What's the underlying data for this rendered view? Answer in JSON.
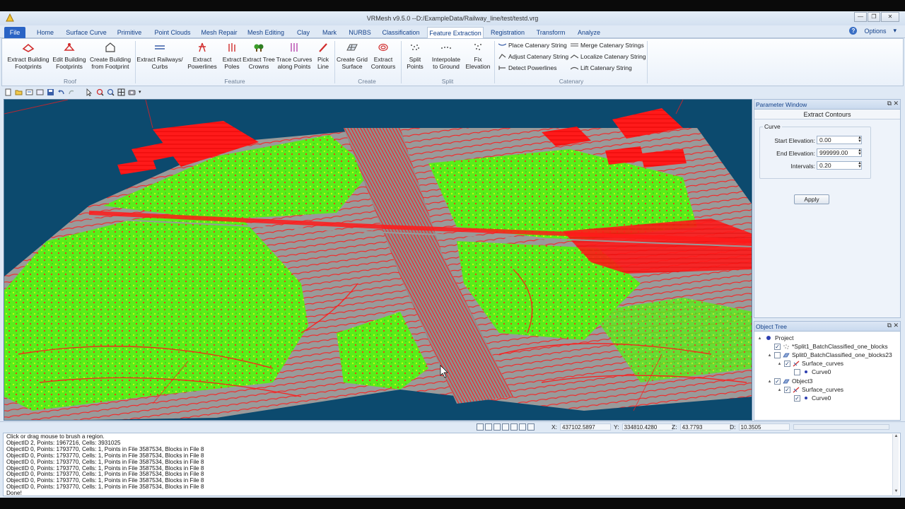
{
  "window": {
    "title": "VRMesh v9.5.0 --D:/ExampleData/Railway_line/test/testd.vrg",
    "buttons": [
      "—",
      "❐",
      "✕"
    ]
  },
  "ribbon_tabs": [
    {
      "label": "File",
      "state": "file"
    },
    {
      "label": "Home",
      "state": ""
    },
    {
      "label": "Surface Curve",
      "state": ""
    },
    {
      "label": "Primitive",
      "state": ""
    },
    {
      "label": "Point Clouds",
      "state": ""
    },
    {
      "label": "Mesh Repair",
      "state": ""
    },
    {
      "label": "Mesh Editing",
      "state": ""
    },
    {
      "label": "Clay",
      "state": ""
    },
    {
      "label": "Mark",
      "state": ""
    },
    {
      "label": "NURBS",
      "state": ""
    },
    {
      "label": "Classification",
      "state": ""
    },
    {
      "label": "Feature Extraction",
      "state": "active"
    },
    {
      "label": "Registration",
      "state": ""
    },
    {
      "label": "Transform",
      "state": ""
    },
    {
      "label": "Analyze",
      "state": ""
    }
  ],
  "options_label": "Options",
  "ribbon": {
    "roof": {
      "label": "Roof",
      "buttons": [
        {
          "line1": "Extract Building",
          "line2": "Footprints",
          "icon": "building-footprint-icon"
        },
        {
          "line1": "Edit Building",
          "line2": "Footprints",
          "icon": "edit-footprint-icon"
        },
        {
          "line1": "Create Building",
          "line2": "from Footprint",
          "icon": "building-icon"
        }
      ]
    },
    "feature": {
      "label": "Feature",
      "buttons": [
        {
          "line1": "Extract Railways/",
          "line2": "Curbs",
          "icon": "railway-icon"
        },
        {
          "line1": "Extract",
          "line2": "Powerlines",
          "icon": "powerline-icon"
        },
        {
          "line1": "Extract",
          "line2": "Poles",
          "icon": "pole-icon"
        },
        {
          "line1": "Extract Tree",
          "line2": "Crowns",
          "icon": "tree-icon"
        },
        {
          "line1": "Trace Curves",
          "line2": "along Points",
          "icon": "trace-curve-icon"
        },
        {
          "line1": "Pick",
          "line2": "Line",
          "icon": "pick-line-icon"
        }
      ]
    },
    "create": {
      "label": "Create",
      "buttons": [
        {
          "line1": "Create Grid",
          "line2": "Surface",
          "icon": "grid-surface-icon"
        },
        {
          "line1": "Extract",
          "line2": "Contours",
          "icon": "contours-icon"
        }
      ]
    },
    "split": {
      "label": "Split",
      "buttons": [
        {
          "line1": "Split",
          "line2": "Points",
          "icon": "split-points-icon"
        },
        {
          "line1": "Interpolate",
          "line2": "to Ground",
          "icon": "interpolate-icon"
        },
        {
          "line1": "Fix",
          "line2": "Elevation",
          "icon": "fix-elevation-icon"
        }
      ]
    },
    "catenary": {
      "label": "Catenary",
      "items": [
        "Place Catenary String",
        "Merge Catenary Strings",
        "Adjust Catenary String",
        "Localize Catenary String",
        "Detect Powerlines",
        "Lift Catenary String"
      ]
    }
  },
  "parameter_window": {
    "title": "Parameter Window",
    "subtitle": "Extract Contours",
    "group_label": "Curve",
    "fields": [
      {
        "label": "Start Elevation:",
        "value": "0.00"
      },
      {
        "label": "End Elevation:",
        "value": "999999.00"
      },
      {
        "label": "Intervals:",
        "value": "0.20"
      }
    ],
    "apply_label": "Apply"
  },
  "object_tree": {
    "title": "Object Tree",
    "nodes": [
      {
        "label": "Project",
        "level": 0,
        "twisty": "▴",
        "check": "",
        "icon": "project-icon"
      },
      {
        "label": "*Split1_BatchClassified_one_blocks",
        "level": 1,
        "twisty": "",
        "check": "✓",
        "icon": "point-cloud-icon"
      },
      {
        "label": "Split0_BatchClassified_one_blocks23",
        "level": 1,
        "twisty": "▴",
        "check": "",
        "icon": "mesh-icon"
      },
      {
        "label": "Surface_curves",
        "level": 2,
        "twisty": "▴",
        "check": "✓",
        "icon": "curve-icon"
      },
      {
        "label": "Curve0",
        "level": 3,
        "twisty": "",
        "check": "",
        "icon": "dot"
      },
      {
        "label": "Object3",
        "level": 1,
        "twisty": "▴",
        "check": "✓",
        "icon": "mesh-icon"
      },
      {
        "label": "Surface_curves",
        "level": 2,
        "twisty": "▴",
        "check": "✓",
        "icon": "curve-icon"
      },
      {
        "label": "Curve0",
        "level": 3,
        "twisty": "",
        "check": "✓",
        "icon": "dot"
      }
    ]
  },
  "status": {
    "x_label": "X:",
    "x_value": "437102.5897",
    "y_label": "Y:",
    "y_value": "334810.4280",
    "z_label": "Z:",
    "z_value": "43.7793",
    "d_label": "D:",
    "d_value": "10.3505"
  },
  "log_lines": [
    " Click or drag mouse to brush a region.",
    "ObjectID 2, Points: 1967216, Cells: 3931025",
    "ObjectID 0, Points: 1793770, Cells: 1, Points in File 3587534, Blocks in File 8",
    "ObjectID 0, Points: 1793770, Cells: 1, Points in File 3587534, Blocks in File 8",
    "ObjectID 0, Points: 1793770, Cells: 1, Points in File 3587534, Blocks in File 8",
    "ObjectID 0, Points: 1793770, Cells: 1, Points in File 3587534, Blocks in File 8",
    "ObjectID 0, Points: 1793770, Cells: 1, Points in File 3587534, Blocks in File 8",
    "ObjectID 0, Points: 1793770, Cells: 1, Points in File 3587534, Blocks in File 8",
    "ObjectID 0, Points: 1793770, Cells: 1, Points in File 3587534, Blocks in File 8",
    "Done!"
  ],
  "colors": {
    "viewport_bg": "#0c4a6e",
    "terrain_gray": "#9a9a9a",
    "vegetation_green": "#5cf21c",
    "contour_red": "#ff1a1a",
    "accent_blue": "#2a64c5"
  }
}
